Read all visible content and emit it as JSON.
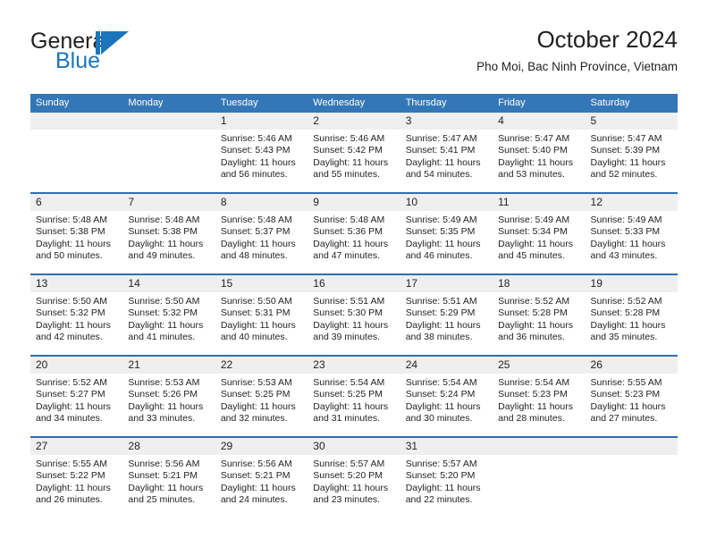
{
  "logo": {
    "word_one": "General",
    "word_two": "Blue",
    "mark_name": "blue-flag-triangle",
    "color_primary": "#1b75bb",
    "color_text": "#231f20"
  },
  "header": {
    "title": "October 2024",
    "subtitle": "Pho Moi, Bac Ninh Province, Vietnam"
  },
  "theme": {
    "header_blue": "#3477b8",
    "divider_blue": "#2f6fae",
    "day_band_gray": "#efefef"
  },
  "weekdays": [
    "Sunday",
    "Monday",
    "Tuesday",
    "Wednesday",
    "Thursday",
    "Friday",
    "Saturday"
  ],
  "weeks": [
    [
      {
        "day": "",
        "lines": []
      },
      {
        "day": "",
        "lines": []
      },
      {
        "day": "1",
        "lines": [
          "Sunrise: 5:46 AM",
          "Sunset: 5:43 PM",
          "Daylight: 11 hours",
          "and 56 minutes."
        ]
      },
      {
        "day": "2",
        "lines": [
          "Sunrise: 5:46 AM",
          "Sunset: 5:42 PM",
          "Daylight: 11 hours",
          "and 55 minutes."
        ]
      },
      {
        "day": "3",
        "lines": [
          "Sunrise: 5:47 AM",
          "Sunset: 5:41 PM",
          "Daylight: 11 hours",
          "and 54 minutes."
        ]
      },
      {
        "day": "4",
        "lines": [
          "Sunrise: 5:47 AM",
          "Sunset: 5:40 PM",
          "Daylight: 11 hours",
          "and 53 minutes."
        ]
      },
      {
        "day": "5",
        "lines": [
          "Sunrise: 5:47 AM",
          "Sunset: 5:39 PM",
          "Daylight: 11 hours",
          "and 52 minutes."
        ]
      }
    ],
    [
      {
        "day": "6",
        "lines": [
          "Sunrise: 5:48 AM",
          "Sunset: 5:38 PM",
          "Daylight: 11 hours",
          "and 50 minutes."
        ]
      },
      {
        "day": "7",
        "lines": [
          "Sunrise: 5:48 AM",
          "Sunset: 5:38 PM",
          "Daylight: 11 hours",
          "and 49 minutes."
        ]
      },
      {
        "day": "8",
        "lines": [
          "Sunrise: 5:48 AM",
          "Sunset: 5:37 PM",
          "Daylight: 11 hours",
          "and 48 minutes."
        ]
      },
      {
        "day": "9",
        "lines": [
          "Sunrise: 5:48 AM",
          "Sunset: 5:36 PM",
          "Daylight: 11 hours",
          "and 47 minutes."
        ]
      },
      {
        "day": "10",
        "lines": [
          "Sunrise: 5:49 AM",
          "Sunset: 5:35 PM",
          "Daylight: 11 hours",
          "and 46 minutes."
        ]
      },
      {
        "day": "11",
        "lines": [
          "Sunrise: 5:49 AM",
          "Sunset: 5:34 PM",
          "Daylight: 11 hours",
          "and 45 minutes."
        ]
      },
      {
        "day": "12",
        "lines": [
          "Sunrise: 5:49 AM",
          "Sunset: 5:33 PM",
          "Daylight: 11 hours",
          "and 43 minutes."
        ]
      }
    ],
    [
      {
        "day": "13",
        "lines": [
          "Sunrise: 5:50 AM",
          "Sunset: 5:32 PM",
          "Daylight: 11 hours",
          "and 42 minutes."
        ]
      },
      {
        "day": "14",
        "lines": [
          "Sunrise: 5:50 AM",
          "Sunset: 5:32 PM",
          "Daylight: 11 hours",
          "and 41 minutes."
        ]
      },
      {
        "day": "15",
        "lines": [
          "Sunrise: 5:50 AM",
          "Sunset: 5:31 PM",
          "Daylight: 11 hours",
          "and 40 minutes."
        ]
      },
      {
        "day": "16",
        "lines": [
          "Sunrise: 5:51 AM",
          "Sunset: 5:30 PM",
          "Daylight: 11 hours",
          "and 39 minutes."
        ]
      },
      {
        "day": "17",
        "lines": [
          "Sunrise: 5:51 AM",
          "Sunset: 5:29 PM",
          "Daylight: 11 hours",
          "and 38 minutes."
        ]
      },
      {
        "day": "18",
        "lines": [
          "Sunrise: 5:52 AM",
          "Sunset: 5:28 PM",
          "Daylight: 11 hours",
          "and 36 minutes."
        ]
      },
      {
        "day": "19",
        "lines": [
          "Sunrise: 5:52 AM",
          "Sunset: 5:28 PM",
          "Daylight: 11 hours",
          "and 35 minutes."
        ]
      }
    ],
    [
      {
        "day": "20",
        "lines": [
          "Sunrise: 5:52 AM",
          "Sunset: 5:27 PM",
          "Daylight: 11 hours",
          "and 34 minutes."
        ]
      },
      {
        "day": "21",
        "lines": [
          "Sunrise: 5:53 AM",
          "Sunset: 5:26 PM",
          "Daylight: 11 hours",
          "and 33 minutes."
        ]
      },
      {
        "day": "22",
        "lines": [
          "Sunrise: 5:53 AM",
          "Sunset: 5:25 PM",
          "Daylight: 11 hours",
          "and 32 minutes."
        ]
      },
      {
        "day": "23",
        "lines": [
          "Sunrise: 5:54 AM",
          "Sunset: 5:25 PM",
          "Daylight: 11 hours",
          "and 31 minutes."
        ]
      },
      {
        "day": "24",
        "lines": [
          "Sunrise: 5:54 AM",
          "Sunset: 5:24 PM",
          "Daylight: 11 hours",
          "and 30 minutes."
        ]
      },
      {
        "day": "25",
        "lines": [
          "Sunrise: 5:54 AM",
          "Sunset: 5:23 PM",
          "Daylight: 11 hours",
          "and 28 minutes."
        ]
      },
      {
        "day": "26",
        "lines": [
          "Sunrise: 5:55 AM",
          "Sunset: 5:23 PM",
          "Daylight: 11 hours",
          "and 27 minutes."
        ]
      }
    ],
    [
      {
        "day": "27",
        "lines": [
          "Sunrise: 5:55 AM",
          "Sunset: 5:22 PM",
          "Daylight: 11 hours",
          "and 26 minutes."
        ]
      },
      {
        "day": "28",
        "lines": [
          "Sunrise: 5:56 AM",
          "Sunset: 5:21 PM",
          "Daylight: 11 hours",
          "and 25 minutes."
        ]
      },
      {
        "day": "29",
        "lines": [
          "Sunrise: 5:56 AM",
          "Sunset: 5:21 PM",
          "Daylight: 11 hours",
          "and 24 minutes."
        ]
      },
      {
        "day": "30",
        "lines": [
          "Sunrise: 5:57 AM",
          "Sunset: 5:20 PM",
          "Daylight: 11 hours",
          "and 23 minutes."
        ]
      },
      {
        "day": "31",
        "lines": [
          "Sunrise: 5:57 AM",
          "Sunset: 5:20 PM",
          "Daylight: 11 hours",
          "and 22 minutes."
        ]
      },
      {
        "day": "",
        "lines": []
      },
      {
        "day": "",
        "lines": []
      }
    ]
  ]
}
